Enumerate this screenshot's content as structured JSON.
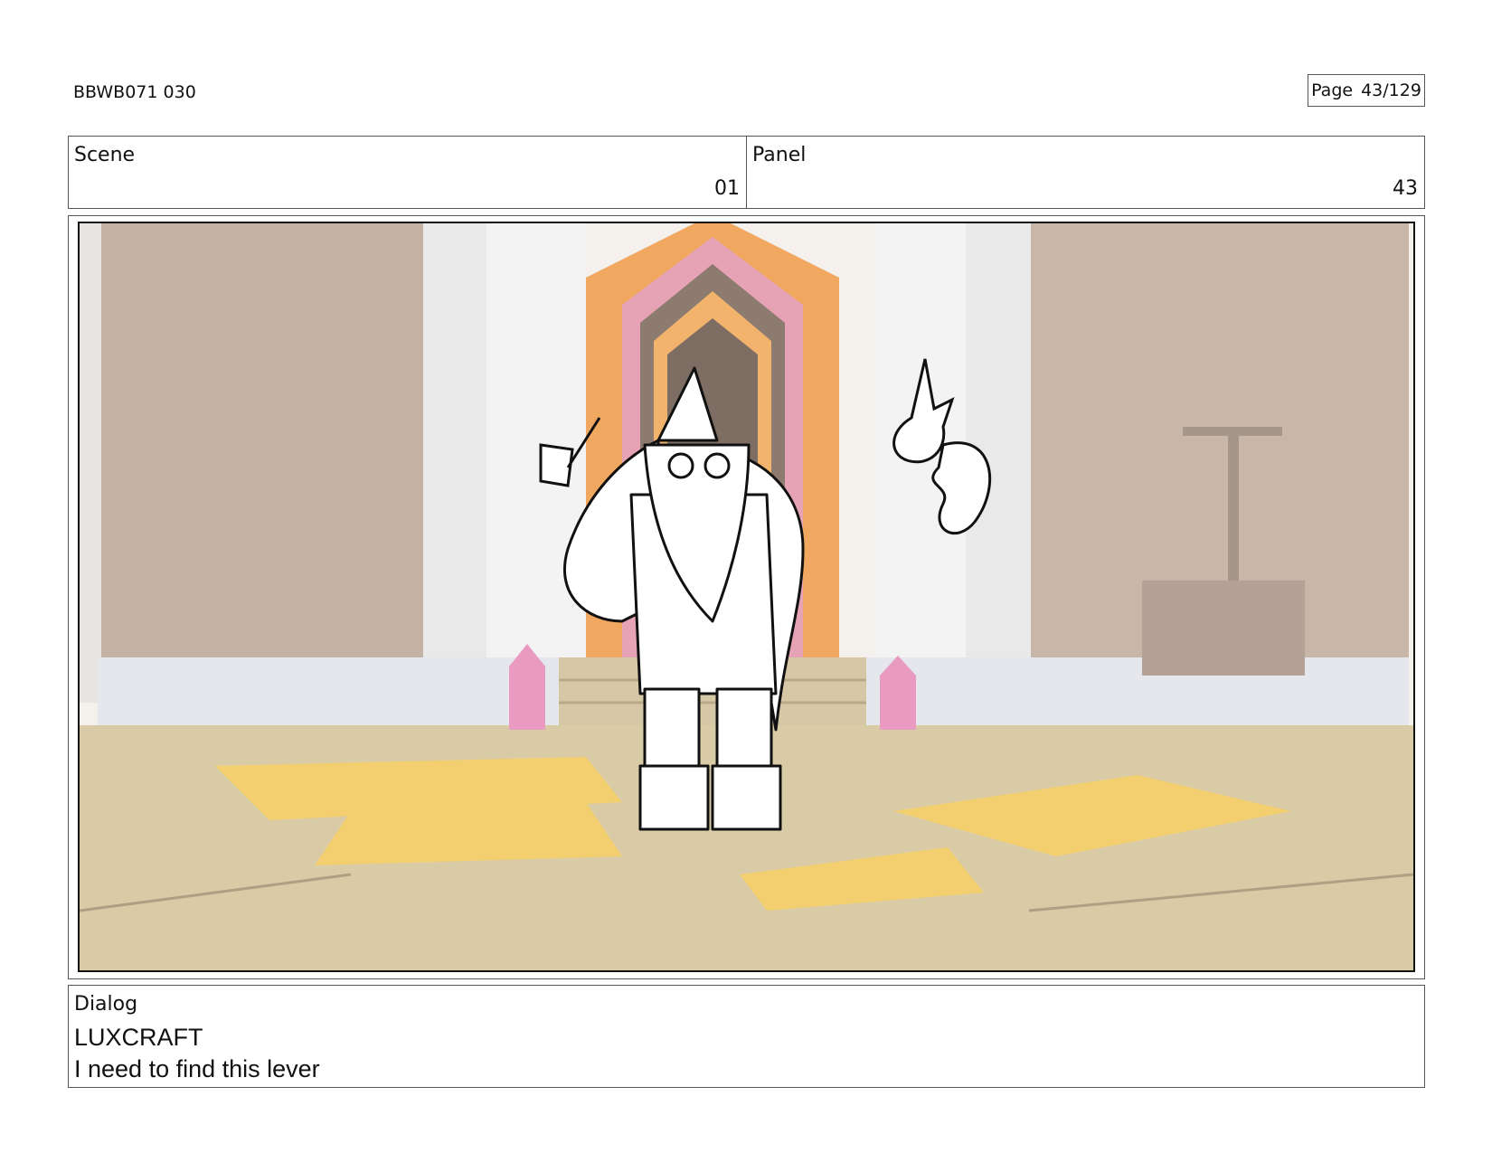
{
  "header": {
    "doc_id": "BBWB071 030",
    "page_label": "Page",
    "page_number": "43/129"
  },
  "info": {
    "scene_label": "Scene",
    "scene_value": "01",
    "panel_label": "Panel",
    "panel_value": "43"
  },
  "frame": {
    "description": "storyboard drawing",
    "icons": [
      "gnome-wizard-figure",
      "floating-spirit-creature",
      "brush-icon",
      "crystal-icon"
    ],
    "colors": {
      "floor": "#d9cba6",
      "wall": "#bfae9f",
      "pillar": "#f2f2f2",
      "doorway_orange": "#f0a860",
      "doorway_pink": "#e6a3b6",
      "crystal": "#e89ac0",
      "floor_tile": "#f3cf6f"
    }
  },
  "dialog": {
    "label": "Dialog",
    "speaker": "LUXCRAFT",
    "line": "I need to find this lever"
  }
}
